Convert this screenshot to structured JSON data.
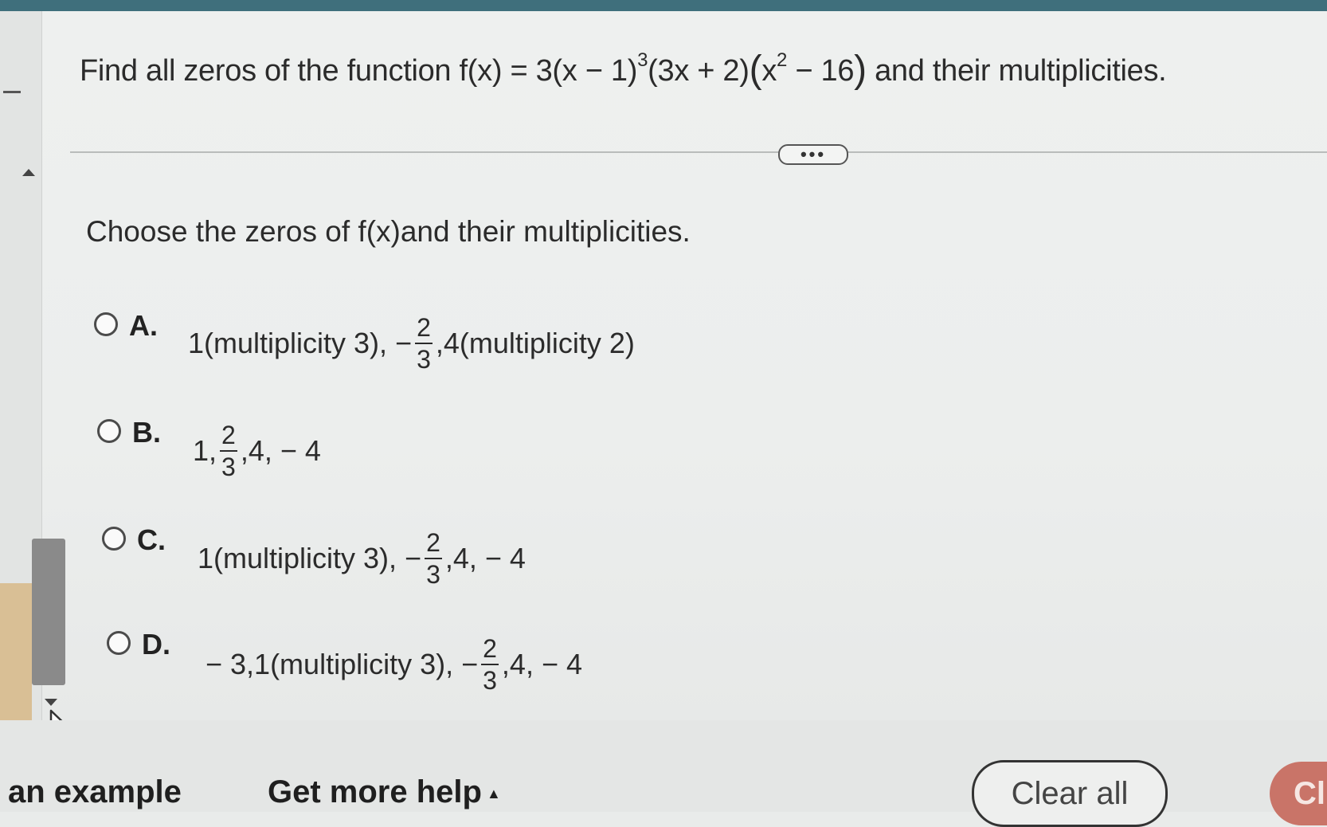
{
  "question": {
    "prefix": "Find all zeros of the function f(x) = 3(x − 1)",
    "exp1": "3",
    "middle": "(3x + 2)",
    "lparen": "(",
    "xterm": "x",
    "exp2": "2",
    "tail": " − 16",
    "rparen": ")",
    "suffix": " and their multiplicities."
  },
  "more_button": "•••",
  "prompt": "Choose the zeros of f(x)and their multiplicities.",
  "options": {
    "a": {
      "letter": "A.",
      "pre": "1(multiplicity 3), −",
      "num": "2",
      "den": "3",
      "post": ",4(multiplicity 2)"
    },
    "b": {
      "letter": "B.",
      "pre": "1,",
      "num": "2",
      "den": "3",
      "post": ",4, − 4"
    },
    "c": {
      "letter": "C.",
      "pre": "1(multiplicity 3), −",
      "num": "2",
      "den": "3",
      "post": ",4, − 4"
    },
    "d": {
      "letter": "D.",
      "pre": "− 3,1(multiplicity 3), −",
      "num": "2",
      "den": "3",
      "post": ",4, − 4"
    }
  },
  "footer": {
    "example": "an example",
    "help": "Get more help",
    "help_caret": "▲",
    "clear": "Clear all",
    "check": "Cl"
  }
}
